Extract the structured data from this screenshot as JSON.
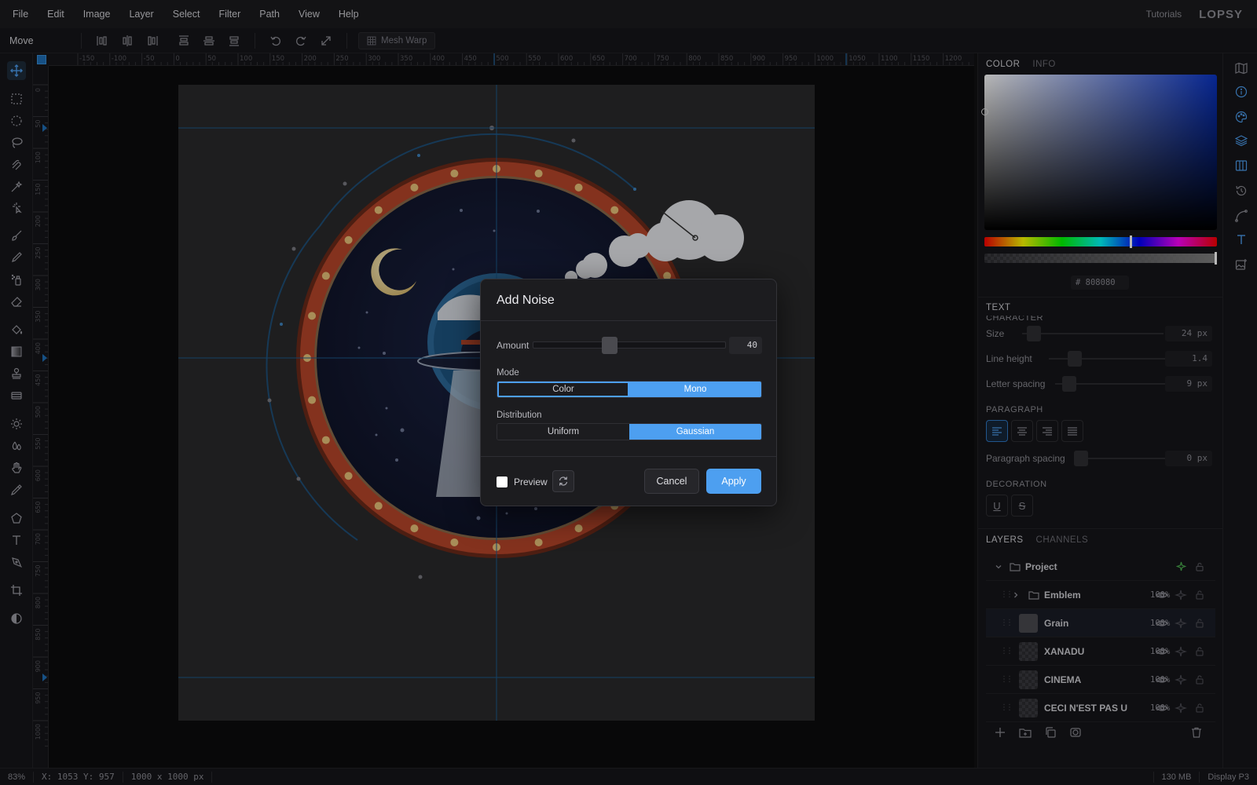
{
  "menu": {
    "items": [
      "File",
      "Edit",
      "Image",
      "Layer",
      "Select",
      "Filter",
      "Path",
      "View",
      "Help"
    ],
    "tutorials": "Tutorials",
    "logo": "LOPSY"
  },
  "options_bar": {
    "tool_name": "Move",
    "mesh_warp": "Mesh Warp"
  },
  "rulers": {
    "top": [
      "-150",
      "-100",
      "-50",
      "0",
      "50",
      "100",
      "150",
      "200",
      "250",
      "300",
      "350",
      "400",
      "450",
      "500",
      "550",
      "600",
      "650",
      "700",
      "750",
      "800",
      "850",
      "900",
      "950",
      "1000",
      "1050",
      "1100",
      "1150",
      "1200"
    ],
    "left": [
      "0",
      "50",
      "100",
      "150",
      "200",
      "250",
      "300",
      "350",
      "400",
      "450",
      "500",
      "550",
      "600",
      "650",
      "700",
      "750",
      "800",
      "850",
      "900",
      "950",
      "1000"
    ]
  },
  "status": {
    "zoom": "83%",
    "coords": "X: 1053  Y: 957",
    "size": "1000 x 1000 px",
    "memory": "130 MB",
    "display": "Display P3"
  },
  "color_panel": {
    "tabs": [
      "COLOR",
      "INFO"
    ],
    "hex_prefix": "#",
    "hex": "808080"
  },
  "text_panel": {
    "title": "TEXT",
    "character_heading": "CHARACTER",
    "size_label": "Size",
    "size_value": "24 px",
    "line_height_label": "Line height",
    "line_height_value": "1.4",
    "letter_spacing_label": "Letter spacing",
    "letter_spacing_value": "9 px",
    "paragraph_heading": "PARAGRAPH",
    "paragraph_spacing_label": "Paragraph spacing",
    "paragraph_spacing_value": "0 px",
    "decoration_heading": "DECORATION",
    "underline": "U",
    "strike": "S"
  },
  "layers_panel": {
    "tabs": [
      "LAYERS",
      "CHANNELS"
    ],
    "project": "Project",
    "layers": [
      {
        "name": "Emblem",
        "opacity": "100%",
        "type": "folder"
      },
      {
        "name": "Grain",
        "opacity": "100%",
        "type": "fill"
      },
      {
        "name": "XANADU",
        "opacity": "100%",
        "type": "text"
      },
      {
        "name": "CINEMA",
        "opacity": "100%",
        "type": "text"
      },
      {
        "name": "CECI N'EST PAS U",
        "opacity": "100%",
        "type": "text"
      }
    ]
  },
  "dialog": {
    "title": "Add Noise",
    "amount_label": "Amount",
    "amount_value": "40",
    "amount": 40,
    "amount_max": 100,
    "mode_label": "Mode",
    "mode_options": [
      "Color",
      "Mono"
    ],
    "mode_selected": "Mono",
    "distribution_label": "Distribution",
    "distribution_options": [
      "Uniform",
      "Gaussian"
    ],
    "distribution_selected": "Gaussian",
    "preview_label": "Preview",
    "cancel": "Cancel",
    "apply": "Apply"
  },
  "colors": {
    "accent": "#4d9ff0",
    "ring": "#b8462a",
    "night": "#0f1428",
    "guide": "#1d5a8c"
  }
}
